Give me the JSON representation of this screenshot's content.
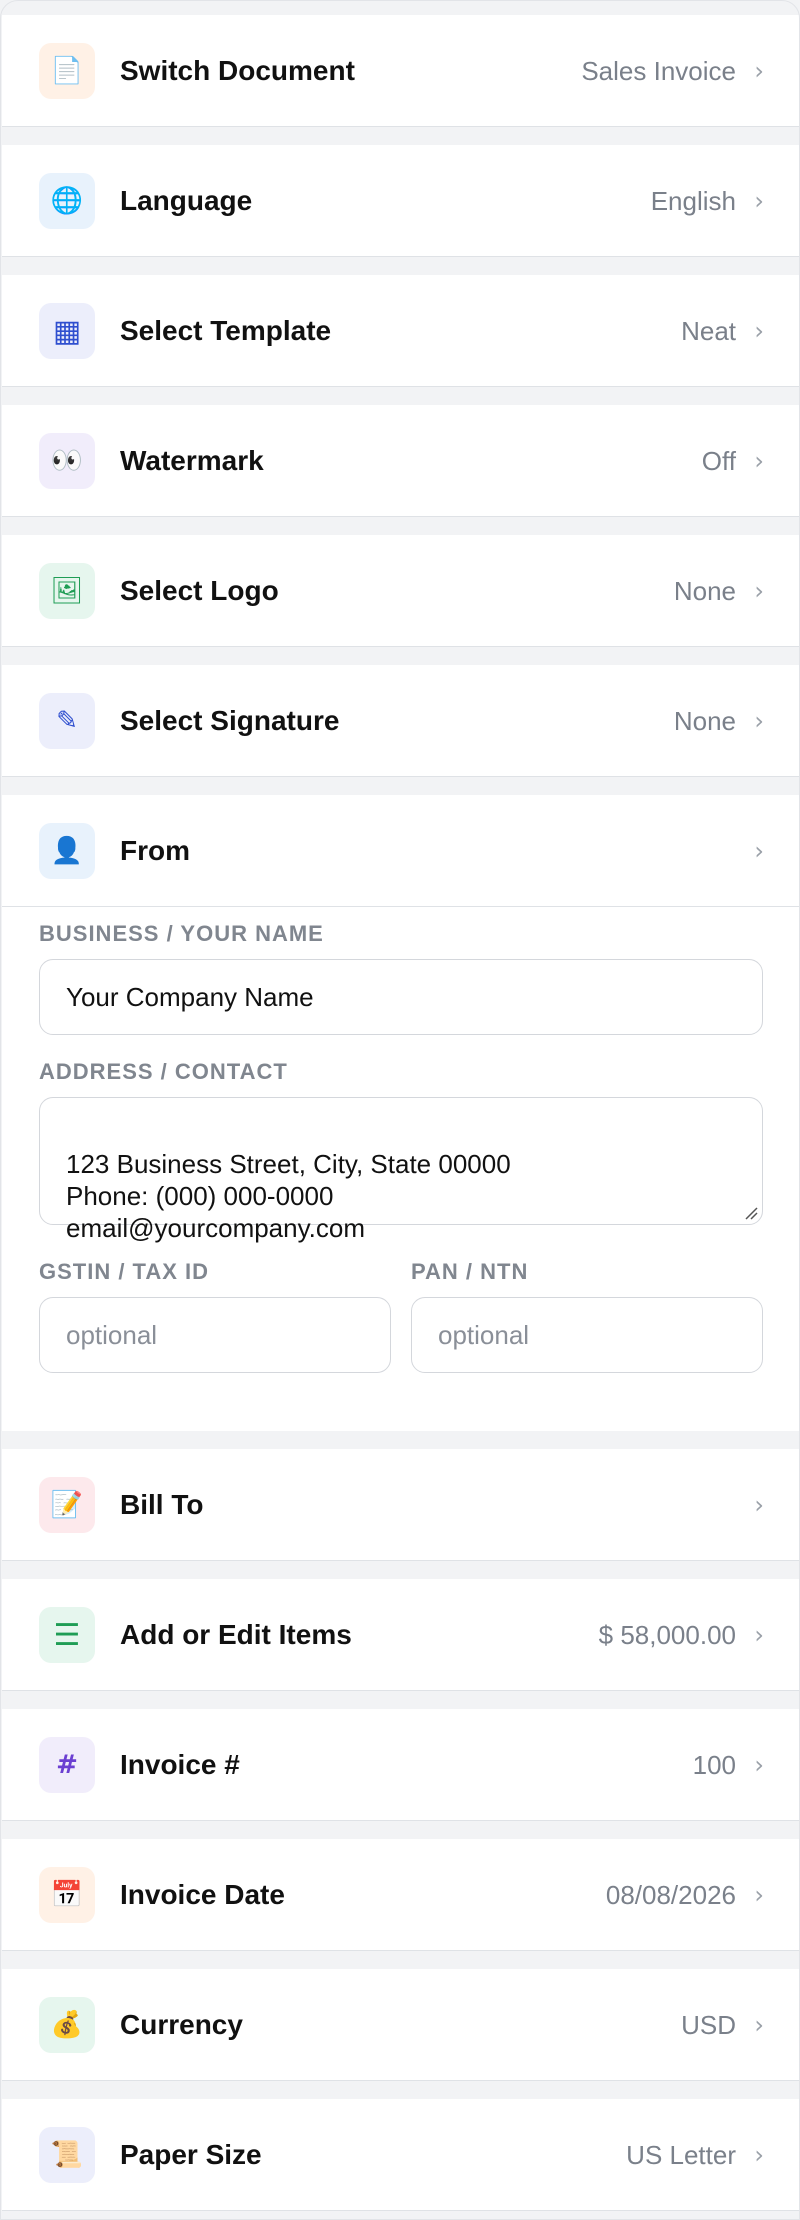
{
  "rows": {
    "switch_document": {
      "icon": "document-icon",
      "glyph": "📄",
      "label": "Switch Document",
      "value": "Sales Invoice"
    },
    "language": {
      "icon": "globe-icon",
      "glyph": "🌐",
      "label": "Language",
      "value": "English"
    },
    "select_template": {
      "icon": "grid-icon",
      "glyph": "▦",
      "label": "Select Template",
      "value": "Neat"
    },
    "watermark": {
      "icon": "eyes-icon",
      "glyph": "👀",
      "label": "Watermark",
      "value": "Off"
    },
    "select_logo": {
      "icon": "image-icon",
      "glyph": "🖼",
      "label": "Select Logo",
      "value": "None"
    },
    "select_signature": {
      "icon": "pen-icon",
      "glyph": "✎",
      "label": "Select Signature",
      "value": "None"
    },
    "from": {
      "icon": "person-icon",
      "glyph": "👤",
      "label": "From",
      "value": ""
    },
    "bill_to": {
      "icon": "memo-icon",
      "glyph": "📝",
      "label": "Bill To",
      "value": ""
    },
    "items": {
      "icon": "list-icon",
      "glyph": "☰",
      "label": "Add or Edit Items",
      "value": "$ 58,000.00"
    },
    "invoice_number": {
      "icon": "hash-icon",
      "glyph": "#",
      "label": "Invoice #",
      "value": "100"
    },
    "invoice_date": {
      "icon": "calendar-icon",
      "glyph": "📅",
      "label": "Invoice Date",
      "value": "08/08/2026"
    },
    "currency": {
      "icon": "money-bag-icon",
      "glyph": "💰",
      "label": "Currency",
      "value": "USD"
    },
    "paper_size": {
      "icon": "scroll-icon",
      "glyph": "📜",
      "label": "Paper Size",
      "value": "US Letter"
    }
  },
  "chevron": "›",
  "from_form": {
    "business_label": "BUSINESS / YOUR NAME",
    "business_value": "Your Company Name",
    "address_label": "ADDRESS / CONTACT",
    "address_value": "123 Business Street, City, State 00000\nPhone: (000) 000-0000\nemail@yourcompany.com",
    "gstin_label": "GSTIN / TAX ID",
    "gstin_placeholder": "optional",
    "pan_label": "PAN / NTN",
    "pan_placeholder": "optional"
  },
  "colors": {
    "icon_orange_bg": "#fff1e6",
    "icon_blue_bg": "#e8f2fc",
    "icon_indigo_bg": "#eceefb",
    "icon_purple_bg": "#f1edfb",
    "icon_green_bg": "#e6f6ee",
    "icon_red_bg": "#fde9ec",
    "accent_green": "#1f9d55",
    "accent_blue": "#2f4fcf",
    "accent_purple": "#6b3fd1"
  }
}
